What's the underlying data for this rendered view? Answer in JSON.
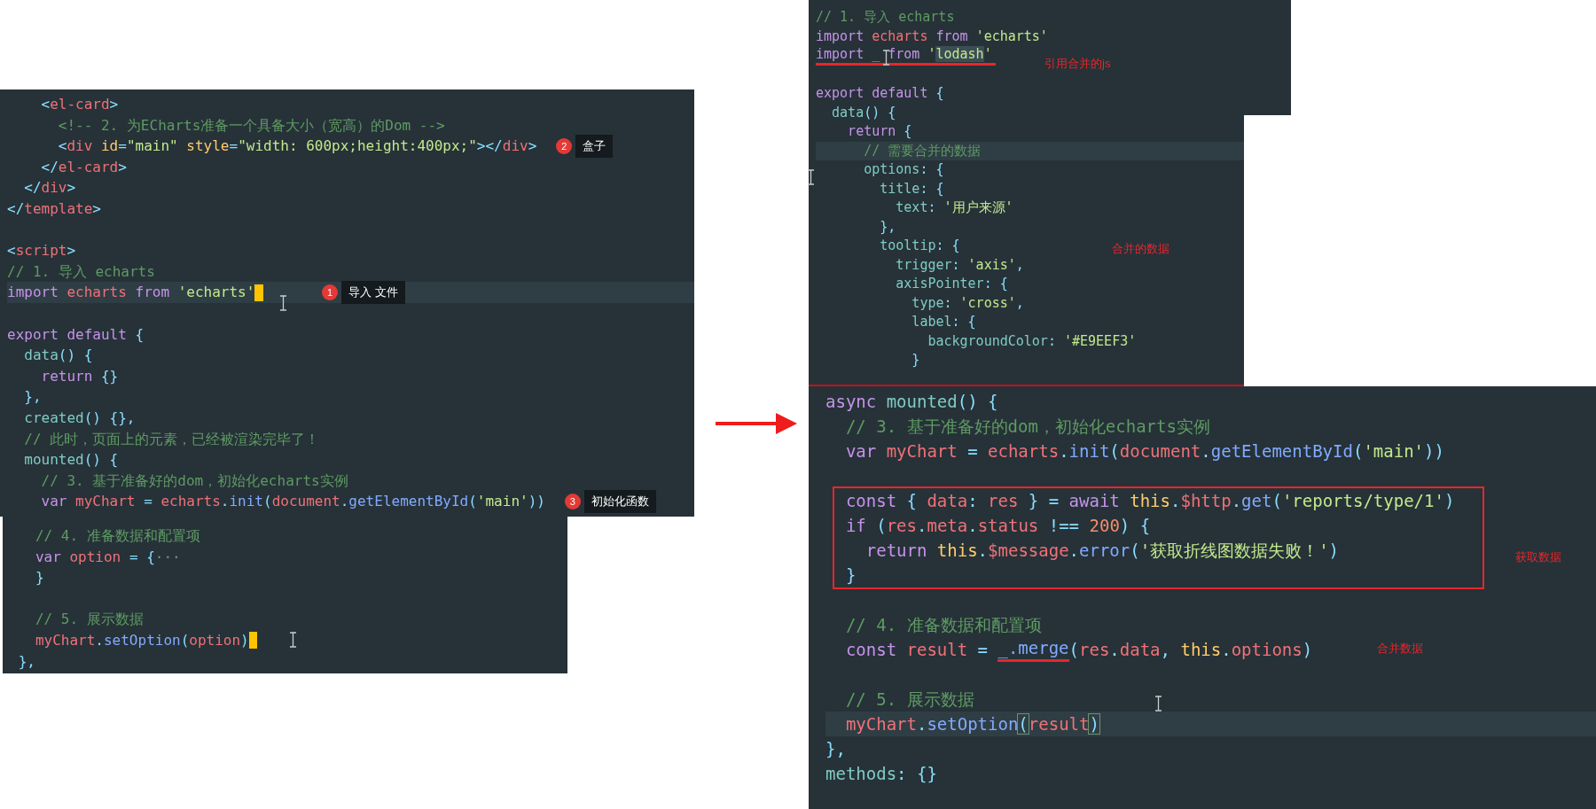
{
  "panels": [
    {
      "lines": [
        {
          "kind": "plain",
          "tokens": [
            {
              "text": "    <",
              "kind": "punctuation"
            },
            {
              "text": "el-card",
              "kind": "tag"
            },
            {
              "text": ">",
              "kind": "punctuation"
            }
          ]
        },
        {
          "kind": "plain",
          "tokens": [
            {
              "text": "      <!-- 2. 为ECharts准备一个具备大小（宽高）的Dom -->",
              "kind": "comment"
            }
          ]
        },
        {
          "kind": "plain",
          "tokens": [
            {
              "text": "      <",
              "kind": "punctuation"
            },
            {
              "text": "div ",
              "kind": "tag"
            },
            {
              "text": "id",
              "kind": "attribute"
            },
            {
              "text": "=",
              "kind": "punctuation"
            },
            {
              "text": "\"main\" ",
              "kind": "string"
            },
            {
              "text": "style",
              "kind": "attribute"
            },
            {
              "text": "=",
              "kind": "punctuation"
            },
            {
              "text": "\"width: 600px;height:400px;\"",
              "kind": "string"
            },
            {
              "text": "></",
              "kind": "punctuation"
            },
            {
              "text": "div",
              "kind": "tag"
            },
            {
              "text": ">",
              "kind": "punctuation"
            }
          ],
          "callout": {
            "number": "2",
            "label": "盒子"
          }
        },
        {
          "kind": "plain",
          "tokens": [
            {
              "text": "    </",
              "kind": "punctuation"
            },
            {
              "text": "el-card",
              "kind": "tag"
            },
            {
              "text": ">",
              "kind": "punctuation"
            }
          ]
        },
        {
          "kind": "plain",
          "tokens": [
            {
              "text": "  </",
              "kind": "punctuation"
            },
            {
              "text": "div",
              "kind": "tag"
            },
            {
              "text": ">",
              "kind": "punctuation"
            }
          ]
        },
        {
          "kind": "plain",
          "tokens": [
            {
              "text": "</",
              "kind": "punctuation"
            },
            {
              "text": "template",
              "kind": "tag"
            },
            {
              "text": ">",
              "kind": "punctuation"
            }
          ]
        },
        {
          "kind": "blank"
        },
        {
          "kind": "plain",
          "tokens": [
            {
              "text": "<",
              "kind": "punctuation"
            },
            {
              "text": "script",
              "kind": "tag"
            },
            {
              "text": ">",
              "kind": "punctuation"
            }
          ]
        },
        {
          "kind": "plain",
          "tokens": [
            {
              "text": "// 1. 导入 echarts",
              "kind": "comment"
            }
          ]
        },
        {
          "kind": "current-caret",
          "tokens": [
            {
              "text": "import ",
              "kind": "keyword"
            },
            {
              "text": "echarts ",
              "kind": "variable"
            },
            {
              "text": "from ",
              "kind": "keyword"
            },
            {
              "text": "'echarts'",
              "kind": "string"
            }
          ],
          "callout": {
            "number": "1",
            "label": "导入 文件"
          }
        },
        {
          "kind": "blank"
        },
        {
          "kind": "plain",
          "tokens": [
            {
              "text": "export default ",
              "kind": "keyword"
            },
            {
              "text": "{",
              "kind": "punctuation"
            }
          ]
        },
        {
          "kind": "plain",
          "tokens": [
            {
              "text": "  data",
              "kind": "property"
            },
            {
              "text": "() {",
              "kind": "punctuation"
            }
          ]
        },
        {
          "kind": "plain",
          "tokens": [
            {
              "text": "    return ",
              "kind": "keyword"
            },
            {
              "text": "{}",
              "kind": "punctuation"
            }
          ]
        },
        {
          "kind": "plain",
          "tokens": [
            {
              "text": "  },",
              "kind": "punctuation"
            }
          ]
        },
        {
          "kind": "plain",
          "tokens": [
            {
              "text": "  created",
              "kind": "property"
            },
            {
              "text": "() {},",
              "kind": "punctuation"
            }
          ]
        },
        {
          "kind": "plain",
          "tokens": [
            {
              "text": "  // 此时，页面上的元素，已经被渲染完毕了！",
              "kind": "comment"
            }
          ]
        },
        {
          "kind": "plain",
          "tokens": [
            {
              "text": "  mounted",
              "kind": "property"
            },
            {
              "text": "() {",
              "kind": "punctuation"
            }
          ]
        },
        {
          "kind": "plain",
          "tokens": [
            {
              "text": "    // 3. 基于准备好的dom，初始化echarts实例",
              "kind": "comment"
            }
          ]
        },
        {
          "kind": "plain",
          "tokens": [
            {
              "text": "    var ",
              "kind": "keyword"
            },
            {
              "text": "myChart ",
              "kind": "variable"
            },
            {
              "text": "= ",
              "kind": "punctuation"
            },
            {
              "text": "echarts",
              "kind": "variable"
            },
            {
              "text": ".",
              "kind": "punctuation"
            },
            {
              "text": "init",
              "kind": "function"
            },
            {
              "text": "(",
              "kind": "punctuation"
            },
            {
              "text": "document",
              "kind": "variable"
            },
            {
              "text": ".",
              "kind": "punctuation"
            },
            {
              "text": "getElementById",
              "kind": "function"
            },
            {
              "text": "(",
              "kind": "punctuation"
            },
            {
              "text": "'main'",
              "kind": "string"
            },
            {
              "text": "))",
              "kind": "punctuation"
            }
          ],
          "callout": {
            "number": "3",
            "label": "初始化函数"
          }
        }
      ]
    },
    {
      "lines": [
        {
          "kind": "plain",
          "tokens": [
            {
              "text": "   // 4. 准备数据和配置项",
              "kind": "comment"
            }
          ]
        },
        {
          "kind": "plain",
          "tokens": [
            {
              "text": "   var ",
              "kind": "keyword"
            },
            {
              "text": "option ",
              "kind": "variable"
            },
            {
              "text": "= {",
              "kind": "punctuation"
            },
            {
              "text": "···",
              "kind": "fold"
            }
          ]
        },
        {
          "kind": "plain",
          "tokens": [
            {
              "text": "   }",
              "kind": "punctuation"
            }
          ]
        },
        {
          "kind": "blank"
        },
        {
          "kind": "plain",
          "tokens": [
            {
              "text": "   // 5. 展示数据",
              "kind": "comment"
            }
          ]
        },
        {
          "kind": "caret",
          "tokens": [
            {
              "text": "   myChart",
              "kind": "variable"
            },
            {
              "text": ".",
              "kind": "punctuation"
            },
            {
              "text": "setOption",
              "kind": "function"
            },
            {
              "text": "(",
              "kind": "punctuation"
            },
            {
              "text": "option",
              "kind": "variable"
            },
            {
              "text": ")",
              "kind": "punctuation"
            }
          ]
        },
        {
          "kind": "plain",
          "tokens": [
            {
              "text": " },",
              "kind": "punctuation"
            }
          ]
        }
      ]
    },
    {
      "lines": [
        {
          "kind": "plain",
          "tokens": [
            {
              "text": "// 1. 导入 echarts",
              "kind": "comment"
            }
          ]
        },
        {
          "kind": "plain",
          "tokens": [
            {
              "text": "import ",
              "kind": "keyword"
            },
            {
              "text": "echarts ",
              "kind": "variable"
            },
            {
              "text": "from ",
              "kind": "keyword"
            },
            {
              "text": "'echarts'",
              "kind": "string"
            }
          ]
        },
        {
          "kind": "underlined",
          "tokens": [
            {
              "text": "import ",
              "kind": "keyword"
            },
            {
              "text": "_ ",
              "kind": "variable"
            },
            {
              "text": "from ",
              "kind": "keyword"
            },
            {
              "text": "'",
              "kind": "string"
            },
            {
              "text": "lodash",
              "kind": "string-match"
            },
            {
              "text": "'",
              "kind": "string"
            }
          ]
        },
        {
          "kind": "blank"
        },
        {
          "kind": "plain",
          "tokens": [
            {
              "text": "export default ",
              "kind": "keyword"
            },
            {
              "text": "{",
              "kind": "punctuation"
            }
          ]
        },
        {
          "kind": "plain",
          "tokens": [
            {
              "text": "  data",
              "kind": "property"
            },
            {
              "text": "() {",
              "kind": "punctuation"
            }
          ]
        },
        {
          "kind": "plain",
          "tokens": [
            {
              "text": "    return ",
              "kind": "keyword"
            },
            {
              "text": "{",
              "kind": "punctuation"
            }
          ]
        },
        {
          "kind": "current",
          "tokens": [
            {
              "text": "      // 需要合并的数据",
              "kind": "comment"
            }
          ]
        },
        {
          "kind": "plain",
          "tokens": [
            {
              "text": "      options",
              "kind": "property"
            },
            {
              "text": ": {",
              "kind": "punctuation"
            }
          ]
        },
        {
          "kind": "plain",
          "tokens": [
            {
              "text": "        title",
              "kind": "property"
            },
            {
              "text": ": {",
              "kind": "punctuation"
            }
          ]
        },
        {
          "kind": "plain",
          "tokens": [
            {
              "text": "          text",
              "kind": "property"
            },
            {
              "text": ": ",
              "kind": "punctuation"
            },
            {
              "text": "'用户来源'",
              "kind": "string"
            }
          ]
        },
        {
          "kind": "plain",
          "tokens": [
            {
              "text": "        },",
              "kind": "punctuation"
            }
          ]
        },
        {
          "kind": "plain",
          "tokens": [
            {
              "text": "        tooltip",
              "kind": "property"
            },
            {
              "text": ": {",
              "kind": "punctuation"
            }
          ]
        },
        {
          "kind": "plain",
          "tokens": [
            {
              "text": "          trigger",
              "kind": "property"
            },
            {
              "text": ": ",
              "kind": "punctuation"
            },
            {
              "text": "'axis'",
              "kind": "string"
            },
            {
              "text": ",",
              "kind": "punctuation"
            }
          ]
        },
        {
          "kind": "plain",
          "tokens": [
            {
              "text": "          axisPointer",
              "kind": "property"
            },
            {
              "text": ": {",
              "kind": "punctuation"
            }
          ]
        },
        {
          "kind": "plain",
          "tokens": [
            {
              "text": "            type",
              "kind": "property"
            },
            {
              "text": ": ",
              "kind": "punctuation"
            },
            {
              "text": "'cross'",
              "kind": "string"
            },
            {
              "text": ",",
              "kind": "punctuation"
            }
          ]
        },
        {
          "kind": "plain",
          "tokens": [
            {
              "text": "            label",
              "kind": "property"
            },
            {
              "text": ": {",
              "kind": "punctuation"
            }
          ]
        },
        {
          "kind": "plain",
          "tokens": [
            {
              "text": "              backgroundColor",
              "kind": "property"
            },
            {
              "text": ": ",
              "kind": "punctuation"
            },
            {
              "text": "'#E9EEF3'",
              "kind": "string"
            }
          ]
        },
        {
          "kind": "plain",
          "tokens": [
            {
              "text": "            }",
              "kind": "punctuation"
            }
          ]
        }
      ],
      "notes": [
        "引用合并的js",
        "合并的数据"
      ]
    },
    {
      "lines": [
        {
          "kind": "plain",
          "tokens": [
            {
              "text": "async ",
              "kind": "keyword"
            },
            {
              "text": "mounted",
              "kind": "property"
            },
            {
              "text": "() {",
              "kind": "punctuation"
            }
          ]
        },
        {
          "kind": "plain",
          "tokens": [
            {
              "text": "  // 3. 基于准备好的dom，初始化echarts实例",
              "kind": "comment"
            }
          ]
        },
        {
          "kind": "plain",
          "tokens": [
            {
              "text": "  var ",
              "kind": "keyword"
            },
            {
              "text": "myChart ",
              "kind": "variable"
            },
            {
              "text": "= ",
              "kind": "punctuation"
            },
            {
              "text": "echarts",
              "kind": "variable"
            },
            {
              "text": ".",
              "kind": "punctuation"
            },
            {
              "text": "init",
              "kind": "function"
            },
            {
              "text": "(",
              "kind": "punctuation"
            },
            {
              "text": "document",
              "kind": "variable"
            },
            {
              "text": ".",
              "kind": "punctuation"
            },
            {
              "text": "getElementById",
              "kind": "function"
            },
            {
              "text": "(",
              "kind": "punctuation"
            },
            {
              "text": "'main'",
              "kind": "string"
            },
            {
              "text": "))",
              "kind": "punctuation"
            }
          ]
        },
        {
          "kind": "blank"
        },
        {
          "kind": "boxed",
          "lines": [
            {
              "kind": "plain",
              "tokens": [
                {
                  "text": "  const ",
                  "kind": "keyword"
                },
                {
                  "text": "{ ",
                  "kind": "punctuation"
                },
                {
                  "text": "data",
                  "kind": "variable"
                },
                {
                  "text": ": ",
                  "kind": "punctuation"
                },
                {
                  "text": "res ",
                  "kind": "variable"
                },
                {
                  "text": "} = ",
                  "kind": "punctuation"
                },
                {
                  "text": "await ",
                  "kind": "keyword"
                },
                {
                  "text": "this",
                  "kind": "this"
                },
                {
                  "text": ".",
                  "kind": "punctuation"
                },
                {
                  "text": "$http",
                  "kind": "variable"
                },
                {
                  "text": ".",
                  "kind": "punctuation"
                },
                {
                  "text": "get",
                  "kind": "function"
                },
                {
                  "text": "(",
                  "kind": "punctuation"
                },
                {
                  "text": "'reports/type/1'",
                  "kind": "string"
                },
                {
                  "text": ")",
                  "kind": "punctuation"
                }
              ]
            },
            {
              "kind": "plain",
              "tokens": [
                {
                  "text": "  if ",
                  "kind": "keyword"
                },
                {
                  "text": "(",
                  "kind": "punctuation"
                },
                {
                  "text": "res",
                  "kind": "variable"
                },
                {
                  "text": ".",
                  "kind": "punctuation"
                },
                {
                  "text": "meta",
                  "kind": "variable"
                },
                {
                  "text": ".",
                  "kind": "punctuation"
                },
                {
                  "text": "status ",
                  "kind": "variable"
                },
                {
                  "text": "!== ",
                  "kind": "punctuation"
                },
                {
                  "text": "200",
                  "kind": "number"
                },
                {
                  "text": ") {",
                  "kind": "punctuation"
                }
              ]
            },
            {
              "kind": "plain",
              "tokens": [
                {
                  "text": "    return ",
                  "kind": "keyword"
                },
                {
                  "text": "this",
                  "kind": "this"
                },
                {
                  "text": ".",
                  "kind": "punctuation"
                },
                {
                  "text": "$message",
                  "kind": "variable"
                },
                {
                  "text": ".",
                  "kind": "punctuation"
                },
                {
                  "text": "error",
                  "kind": "function"
                },
                {
                  "text": "(",
                  "kind": "punctuation"
                },
                {
                  "text": "'获取折线图数据失败！'",
                  "kind": "string"
                },
                {
                  "text": ")",
                  "kind": "punctuation"
                }
              ]
            },
            {
              "kind": "plain",
              "tokens": [
                {
                  "text": "  }",
                  "kind": "punctuation"
                }
              ]
            }
          ]
        },
        {
          "kind": "blank"
        },
        {
          "kind": "plain",
          "tokens": [
            {
              "text": "  // 4. 准备数据和配置项",
              "kind": "comment"
            }
          ]
        },
        {
          "kind": "plain",
          "tokens": [
            {
              "text": "  const ",
              "kind": "keyword"
            },
            {
              "text": "result ",
              "kind": "variable"
            },
            {
              "text": "= ",
              "kind": "punctuation"
            },
            {
              "text": "_.merge",
              "kind": "function-underline"
            },
            {
              "text": "(",
              "kind": "punctuation"
            },
            {
              "text": "res",
              "kind": "variable"
            },
            {
              "text": ".",
              "kind": "punctuation"
            },
            {
              "text": "data",
              "kind": "variable"
            },
            {
              "text": ", ",
              "kind": "punctuation"
            },
            {
              "text": "this",
              "kind": "this"
            },
            {
              "text": ".",
              "kind": "punctuation"
            },
            {
              "text": "options",
              "kind": "variable"
            },
            {
              "text": ")",
              "kind": "punctuation"
            }
          ]
        },
        {
          "kind": "blank"
        },
        {
          "kind": "plain",
          "tokens": [
            {
              "text": "  // 5. 展示数据",
              "kind": "comment"
            }
          ]
        },
        {
          "kind": "current",
          "tokens": [
            {
              "text": "  myChart",
              "kind": "variable"
            },
            {
              "text": ".",
              "kind": "punctuation"
            },
            {
              "text": "setOption",
              "kind": "function"
            },
            {
              "text": "(",
              "kind": "punctuation-bracket"
            },
            {
              "text": "result",
              "kind": "variable"
            },
            {
              "text": ")",
              "kind": "punctuation-bracket"
            }
          ]
        },
        {
          "kind": "plain",
          "tokens": [
            {
              "text": "},",
              "kind": "punctuation"
            }
          ]
        },
        {
          "kind": "plain",
          "tokens": [
            {
              "text": "methods",
              "kind": "property"
            },
            {
              "text": ": {}",
              "kind": "punctuation"
            }
          ]
        }
      ],
      "notes": [
        "获取数据",
        "合并数据"
      ]
    }
  ]
}
